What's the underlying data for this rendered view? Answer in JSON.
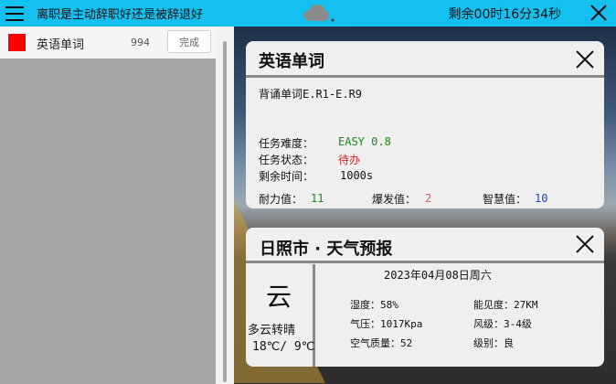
{
  "topbar": {
    "question": "离职是主动辞职好还是被辞退好",
    "weather_icon": "cloud-icon",
    "countdown": "剩余00时16分34秒"
  },
  "task_list": [
    {
      "title": "英语单词",
      "count": "994",
      "done_label": "完成",
      "color": "#ff0000"
    }
  ],
  "word_card": {
    "title": "英语单词",
    "description": "背诵单词E.R1-E.R9",
    "difficulty_label": "任务难度：",
    "difficulty_value": "EASY 0.8",
    "status_label": "任务状态：",
    "status_value": "待办",
    "time_label": "剩余时间：",
    "time_value": "1000s",
    "stamina_label": "耐力值：",
    "stamina_value": "11",
    "burst_label": "爆发值：",
    "burst_value": "2",
    "wisdom_label": "智慧值：",
    "wisdom_value": "10",
    "colors": {
      "difficulty": "#1a8a1a",
      "status": "#e02020",
      "stamina": "#1a8a1a",
      "burst": "#d06060",
      "wisdom": "#2040d0"
    }
  },
  "weather_card": {
    "title": "日照市 · 天气预报",
    "big_char": "云",
    "condition": "多云转晴",
    "temperature": "18℃/ 9℃",
    "date": "2023年04月08日周六",
    "humidity": "湿度：58%",
    "visibility": "能见度：27KM",
    "pressure": "气压：1017Kpa",
    "wind": "风级：3-4级",
    "air_quality": "空气质量：52",
    "level": "级别：良"
  }
}
